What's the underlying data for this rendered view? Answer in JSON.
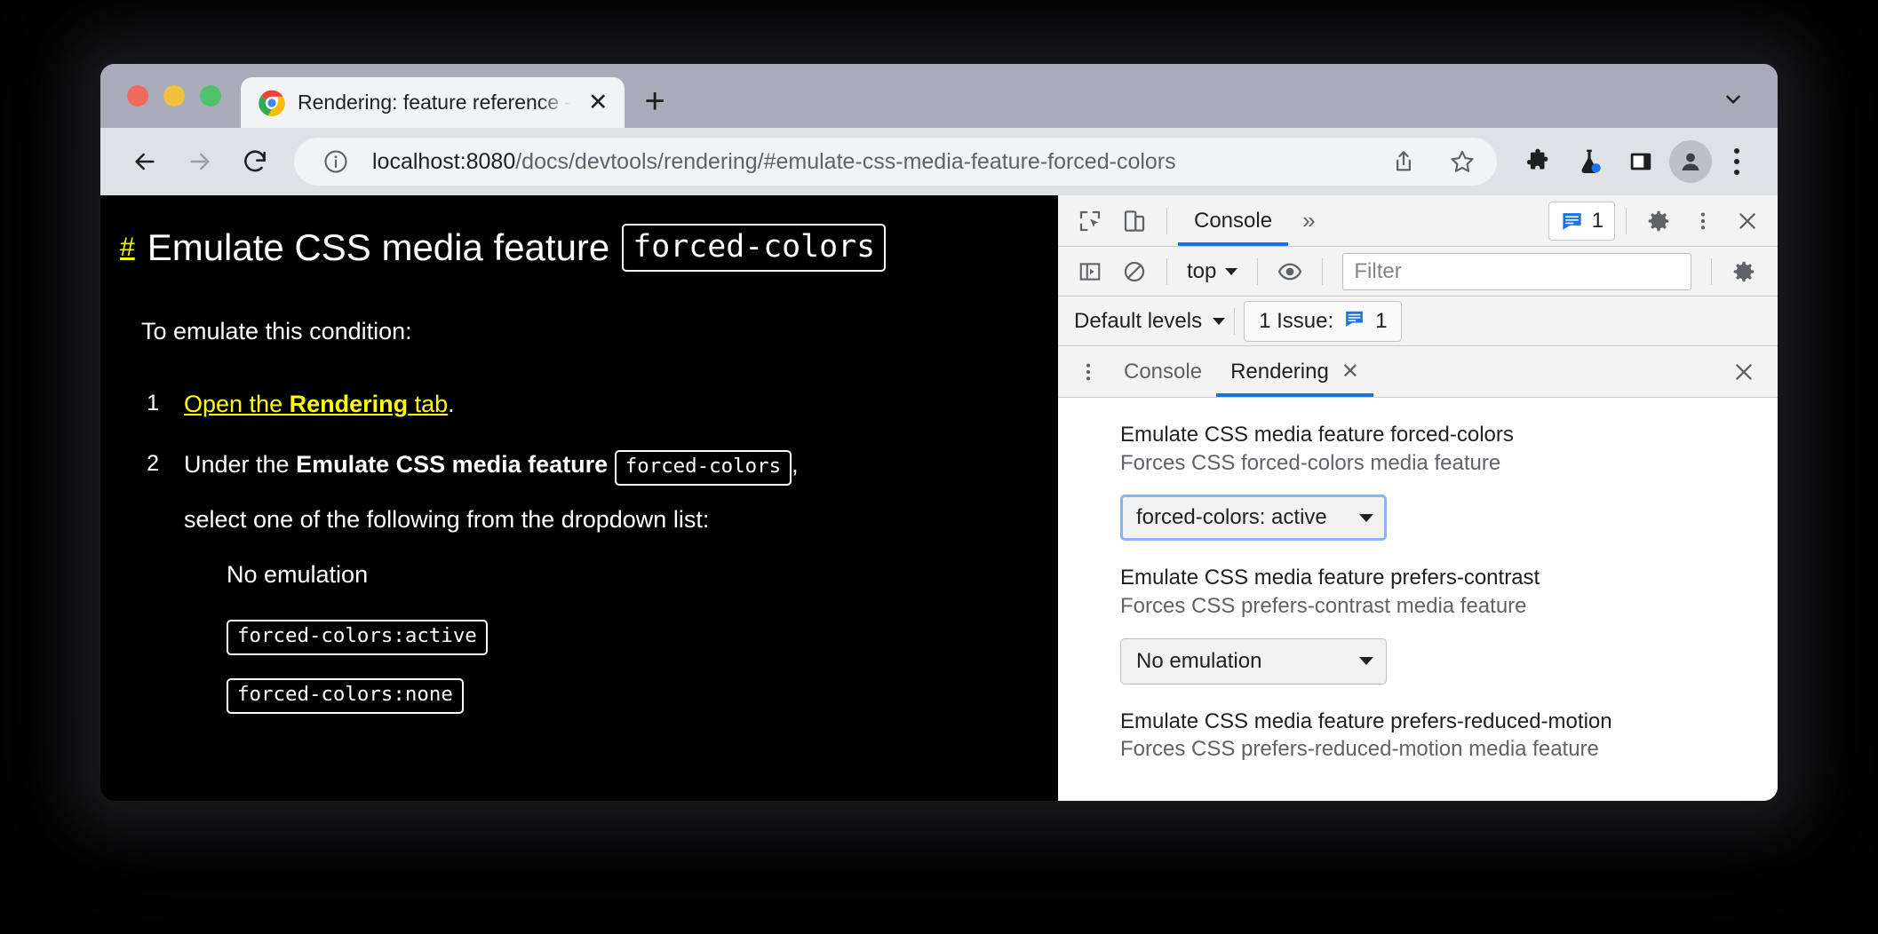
{
  "browser": {
    "tab": {
      "title": "Rendering: feature reference -",
      "close_label": "✕",
      "favicon": "chrome-icon"
    },
    "new_tab_label": "+",
    "tabstrip_chevron": "chevron-down-icon",
    "nav": {
      "back": "back-arrow-icon",
      "forward": "forward-arrow-icon",
      "reload": "reload-icon"
    },
    "omnibox": {
      "info_icon": "info-circle-icon",
      "host": "localhost:8080",
      "path": "/docs/devtools/rendering/#emulate-css-media-feature-forced-colors",
      "share_icon": "share-icon",
      "bookmark_icon": "star-icon"
    },
    "toolbar_icons": [
      "extensions-puzzle-icon",
      "lab-flask-icon",
      "side-panel-icon",
      "profile-avatar-icon",
      "chrome-menu-kebab-icon"
    ]
  },
  "page": {
    "heading_anchor": "#",
    "heading_text": "Emulate CSS media feature",
    "heading_code": "forced-colors",
    "lead": "To emulate this condition:",
    "steps": [
      {
        "num": "1",
        "link_prefix": "Open the ",
        "link_bold": "Rendering",
        "link_suffix": " tab",
        "tail": "."
      },
      {
        "num": "2",
        "prefix": "Under the ",
        "bold": "Emulate CSS media feature",
        "code": "forced-colors",
        "tail": ",",
        "line2": "select one of the following from the dropdown list:",
        "options": [
          "No emulation",
          "forced-colors:active",
          "forced-colors:none"
        ]
      }
    ]
  },
  "devtools": {
    "main_toolbar": {
      "inspect_icon": "inspect-element-icon",
      "device_icon": "device-toolbar-icon",
      "tabs": [
        {
          "label": "Console",
          "active": true
        }
      ],
      "overflow_label": "»",
      "issues_count": "1",
      "issues_icon": "issues-message-icon",
      "settings_icon": "gear-icon",
      "more_icon": "kebab-menu-icon",
      "close_icon": "close-icon"
    },
    "console_filter_bar": {
      "sidebar_icon": "console-sidebar-icon",
      "clear_icon": "clear-console-icon",
      "context": "top",
      "eye_icon": "live-expression-eye-icon",
      "filter_placeholder": "Filter",
      "settings_icon": "gear-icon"
    },
    "console_levels_bar": {
      "levels_label": "Default levels",
      "issues_label": "1 Issue:",
      "issues_icon": "issues-message-icon",
      "issues_count": "1"
    },
    "drawer": {
      "menu_icon": "kebab-menu-icon",
      "tabs": [
        {
          "label": "Console",
          "active": false,
          "closable": false
        },
        {
          "label": "Rendering",
          "active": true,
          "closable": true,
          "close_label": "✕"
        }
      ],
      "close_icon": "close-icon"
    },
    "rendering_panel": {
      "groups": [
        {
          "title": "Emulate CSS media feature forced-colors",
          "subtitle": "Forces CSS forced-colors media feature",
          "select_value": "forced-colors: active",
          "focused": true
        },
        {
          "title": "Emulate CSS media feature prefers-contrast",
          "subtitle": "Forces CSS prefers-contrast media feature",
          "select_value": "No emulation",
          "focused": false
        },
        {
          "title": "Emulate CSS media feature prefers-reduced-motion",
          "subtitle": "Forces CSS prefers-reduced-motion media feature",
          "select_value": "",
          "focused": false
        }
      ]
    }
  },
  "colors": {
    "accent": "#1a73e8",
    "focus_ring": "#8ab4f8",
    "forced_link": "#ffff00",
    "page_bg": "#000000",
    "page_fg": "#ffffff"
  }
}
